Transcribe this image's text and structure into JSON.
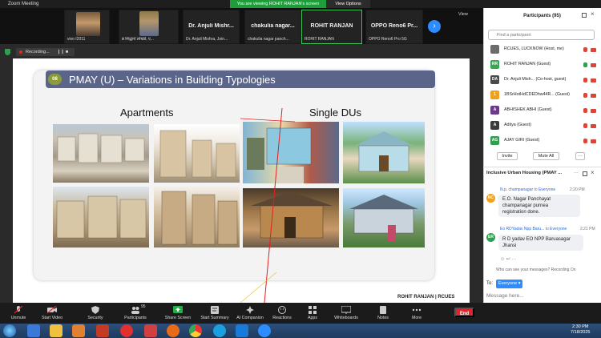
{
  "window": {
    "title": "Zoom Meeting",
    "viewing_banner": "You are viewing ROHIT RANJAN's screen",
    "view_options": "View Options"
  },
  "strip": {
    "tiles": [
      {
        "name": "vivo I2011"
      },
      {
        "name": "ब्र सिद्धार्थ लोखंडे, ए..."
      },
      {
        "big": "Dr. Anjuli Mishr...",
        "name": "Dr. Anjuli Mishra, Join..."
      },
      {
        "big": "chakulia nagar...",
        "name": "chakulia nagar panch..."
      },
      {
        "big": "ROHIT RANJAN",
        "name": "ROHIT RANJAN"
      },
      {
        "big": "OPPO Reno6 Pr...",
        "name": "OPPO Reno6 Pro 5G"
      }
    ],
    "view_label": "View",
    "next_icon": "chevron-right-icon"
  },
  "recording": {
    "label": "Recording...",
    "controls": "❙❙  ■"
  },
  "slide": {
    "number": "08",
    "title": "PMAY (U) – Variations in Building Typologies",
    "left_heading": "Apartments",
    "right_heading": "Single DUs",
    "presenter_tag": "ROHIT RANJAN | RCUES"
  },
  "participants": {
    "header": "Participants (95)",
    "search_placeholder": "Find a participant",
    "list": [
      {
        "initials": "",
        "name": "RCUES, LUCKNOW (Host, me)",
        "color": "#6b6b6b"
      },
      {
        "initials": "RR",
        "name": "ROHIT RANJAN (Guest)",
        "color": "#37a852"
      },
      {
        "initials": "DA",
        "name": "Dr. Anjuli Mish... (Co-host, guest)",
        "color": "#4a4a4a"
      },
      {
        "initials": "1",
        "name": "1BSrHotHdCDEDhw44R... (Guest)",
        "color": "#f0a020"
      },
      {
        "initials": "A",
        "name": "ABHISHEK ABHI (Guest)",
        "color": "#6a3a8a"
      },
      {
        "initials": "A",
        "name": "Aditya (Guest)",
        "color": "#3a3a3a"
      },
      {
        "initials": "AG",
        "name": "AJAY GIRI (Guest)",
        "color": "#2e9e4f"
      }
    ],
    "invite_label": "Invite",
    "mute_all_label": "Mute All",
    "more_label": "···"
  },
  "chat": {
    "header": "Inclusive Urban Housing (PMAY ...",
    "messages": [
      {
        "initials": "NC",
        "sender": "N.p. champanagar",
        "to": "to",
        "audience": "Everyone",
        "time": "2:20 PM",
        "lines": [
          "E.O. Nagar Panchayat",
          "champanagar purnea",
          "registration done."
        ],
        "color": "#f0a020"
      },
      {
        "initials": "ER",
        "sender": "Eo RDYadav Npp Baru...",
        "to": "to",
        "audience": "Everyone",
        "time": "2:21 PM",
        "lines": [
          "R D yadav EO NPP Baruasagar",
          "Jhansi"
        ],
        "color": "#2e9e4f"
      }
    ],
    "who_can_see": "Who can see your messages? Recording On",
    "to_label": "To:",
    "to_value": "Everyone ▾",
    "input_placeholder": "Message here..."
  },
  "toolbar": {
    "items": [
      {
        "label": "Unmute"
      },
      {
        "label": "Start Video"
      },
      {
        "label": "Security"
      },
      {
        "label": "Participants",
        "badge": "95"
      },
      {
        "label": "Share Screen"
      },
      {
        "label": "Start Summary"
      },
      {
        "label": "AI Companion"
      },
      {
        "label": "Reactions"
      },
      {
        "label": "Apps"
      },
      {
        "label": "Whiteboards"
      },
      {
        "label": "Notes"
      },
      {
        "label": "More"
      }
    ],
    "end_label": "End"
  },
  "taskbar": {
    "time": "2:30 PM",
    "date": "7/18/2025"
  }
}
